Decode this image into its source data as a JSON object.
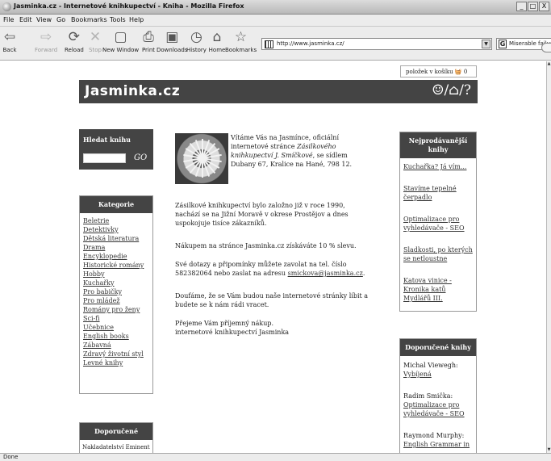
{
  "window": {
    "title": "Jasminka.cz - Internetové knihkupectví - Kniha - Mozilla Firefox",
    "buttons": [
      "_",
      "□",
      "X"
    ]
  },
  "menu": [
    "File",
    "Edit",
    "View",
    "Go",
    "Bookmarks",
    "Tools",
    "Help"
  ],
  "toolbar": {
    "back": "Back",
    "forward": "Forward",
    "reload": "Reload",
    "stop": "Stop",
    "new_window": "New Window",
    "print": "Print",
    "downloads": "Downloads",
    "history": "History",
    "home": "Home",
    "bookmarks": "Bookmarks"
  },
  "address": {
    "url": "http://www.jasminka.cz/"
  },
  "search": {
    "value": "Miserable failure",
    "engine_icon": "G"
  },
  "status": {
    "text": "Done"
  },
  "page": {
    "cart": {
      "label": "položek v košíku",
      "count": "0"
    },
    "logo": "Jasminka.cz",
    "logo_icons": "☺/⌂/?",
    "search_box": {
      "title": "Hledat knihu",
      "go": "GO"
    },
    "categories": {
      "title": "Kategorie",
      "items": [
        "Beletrie",
        "Detektivky",
        "Dětská literatura",
        "Drama",
        "Encyklopedie",
        "Historické romány",
        "Hobby",
        "Kuchařky",
        "Pro babičky",
        "Pro mládež",
        "Romány pro ženy",
        "Sci-fi",
        "Učebnice",
        "English books",
        "Zábavná",
        "Zdravý životní styl",
        "Levné knihy"
      ]
    },
    "recommended_left": {
      "title": "Doporučené",
      "first": "Nakladatelství Eminent"
    },
    "welcome": {
      "intro": "Vítáme Vás na Jasmínce, oficiální internetové stránce",
      "company": "Zásilkového knihkupectví J. Smíčkové",
      "address": ", se sídlem Dubany 67, Kralice na Hané, 798 12."
    },
    "paragraphs": {
      "history": "Zásilkové knihkupectví bylo založno již v roce 1990, nachází se na Jižní Moravě v okrese Prostějov a dnes uspokojuje tisíce zákazníků.",
      "discount": "Nákupem na stránce Jasminka.cz získáváte 10 % slevu.",
      "contact_pre": "Své dotazy a připomínky můžete zavolat na tel. číslo 582382064 nebo zaslat na adresu",
      "email": "smickova@jasminka.cz",
      "contact_post": ".",
      "hope": "Doufáme, že se Vám budou naše internetové stránky líbit a budete se k nám rádi vracet.",
      "wish": "Přejeme Vám příjemný nákup.",
      "signature": "internetové knihkupectví Jasminka"
    },
    "bestsellers": {
      "title": "Nejprodávanější knihy",
      "items": [
        "Kuchařka? Já vím...",
        "Stavíme tepelné čerpadlo",
        "Optimalizace pro vyhledávače - SEO",
        "Sladkosti, po kterých se netloustne",
        "Katova vinice - Kronika katů Mydlářů III."
      ]
    },
    "recommended_books": {
      "title": "Doporučené knihy",
      "items": [
        {
          "author": "Michal Viewegh:",
          "title": "Vybíjená"
        },
        {
          "author": "Radim Smička:",
          "title": "Optimalizace pro vyhledávače - SEO"
        },
        {
          "author": "Raymond Murphy:",
          "title": "English Grammar in"
        }
      ]
    }
  }
}
